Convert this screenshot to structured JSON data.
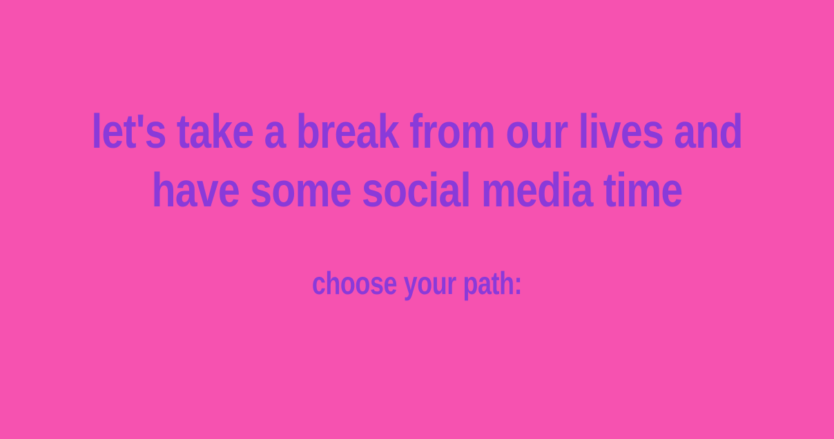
{
  "headline": {
    "line1": "let's take a break from our lives and",
    "line2": "have some social media time"
  },
  "prompt": {
    "text": "choose your path:"
  },
  "colors": {
    "background": "#f652b0",
    "text": "#8a3ad9"
  }
}
